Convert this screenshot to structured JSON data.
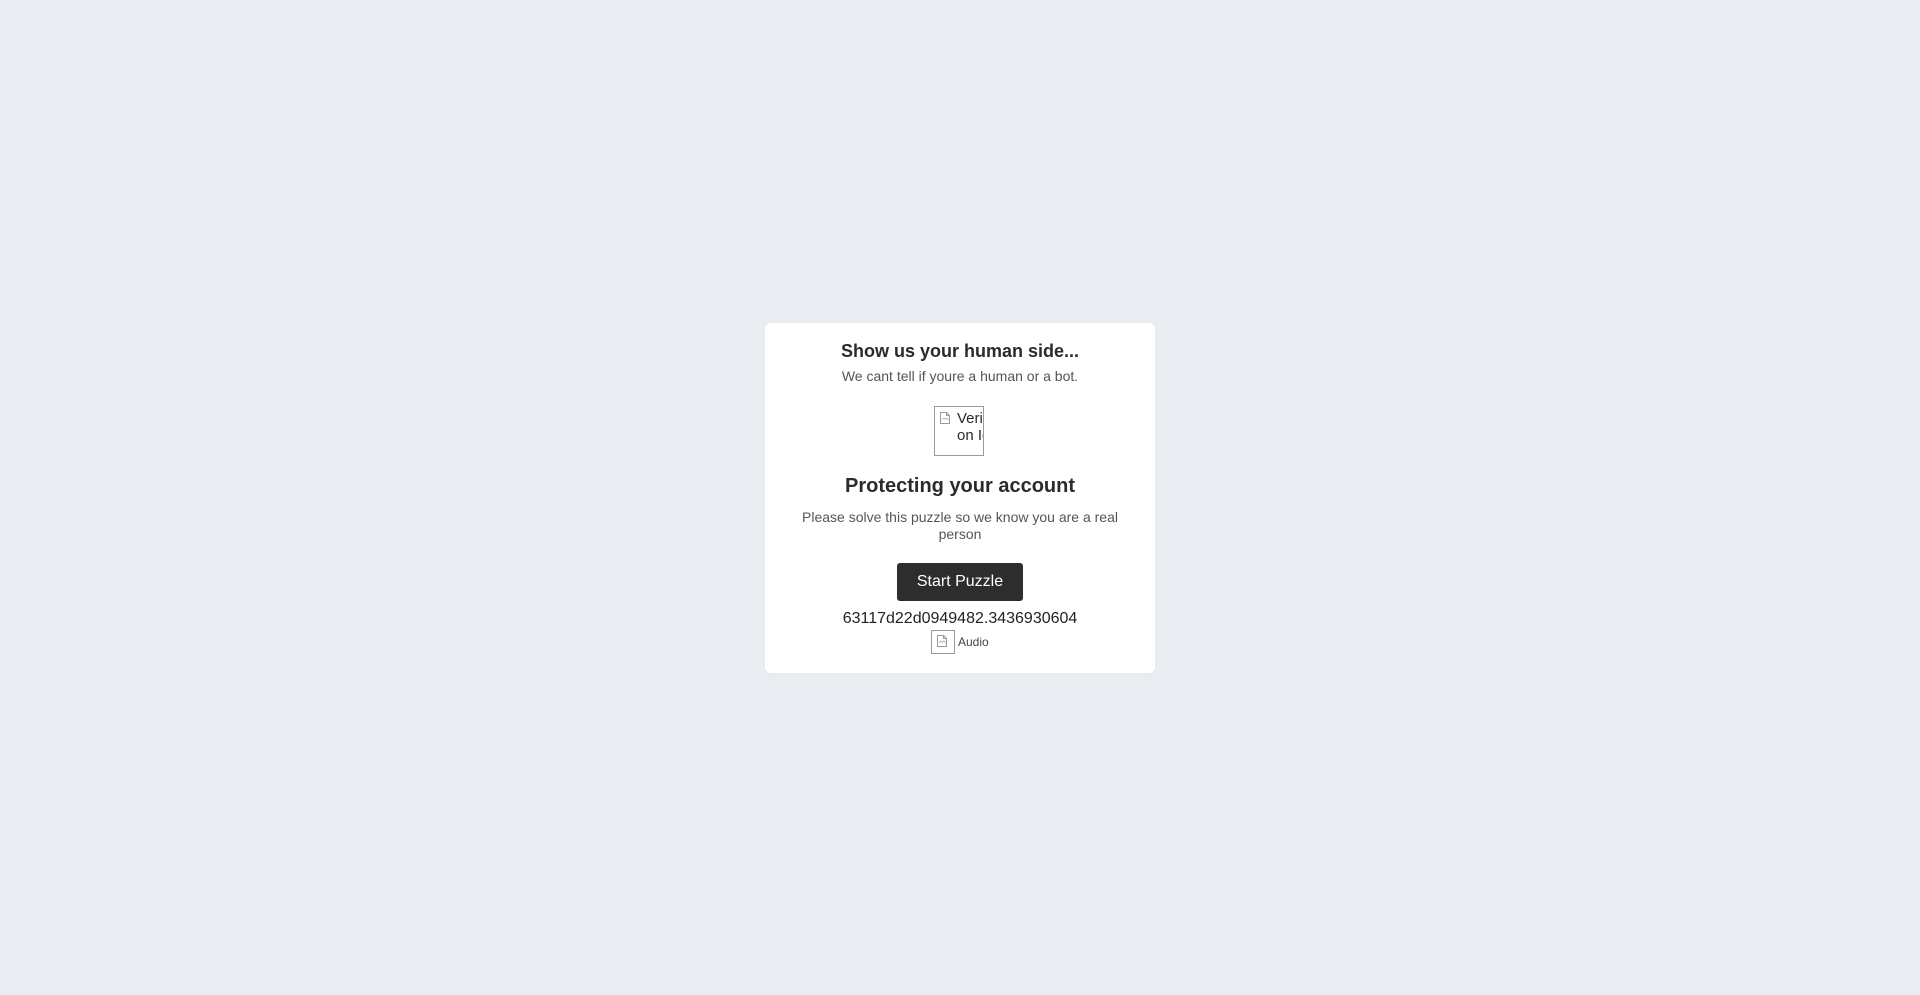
{
  "card": {
    "heading": "Show us your human side...",
    "subheading": "We cant tell if youre a human or a bot.",
    "icon_alt": "Verification Icon",
    "title": "Protecting your account",
    "description": "Please solve this puzzle so we know you are a real person",
    "start_button_label": "Start Puzzle",
    "session_token": "63117d22d0949482.3436930604",
    "audio_label": "Audio"
  },
  "icons": {
    "broken_image": "broken-image-icon",
    "audio": "audio-icon"
  },
  "colors": {
    "background": "#e9ecf1",
    "card": "#ffffff",
    "button": "#2d2d2d"
  }
}
